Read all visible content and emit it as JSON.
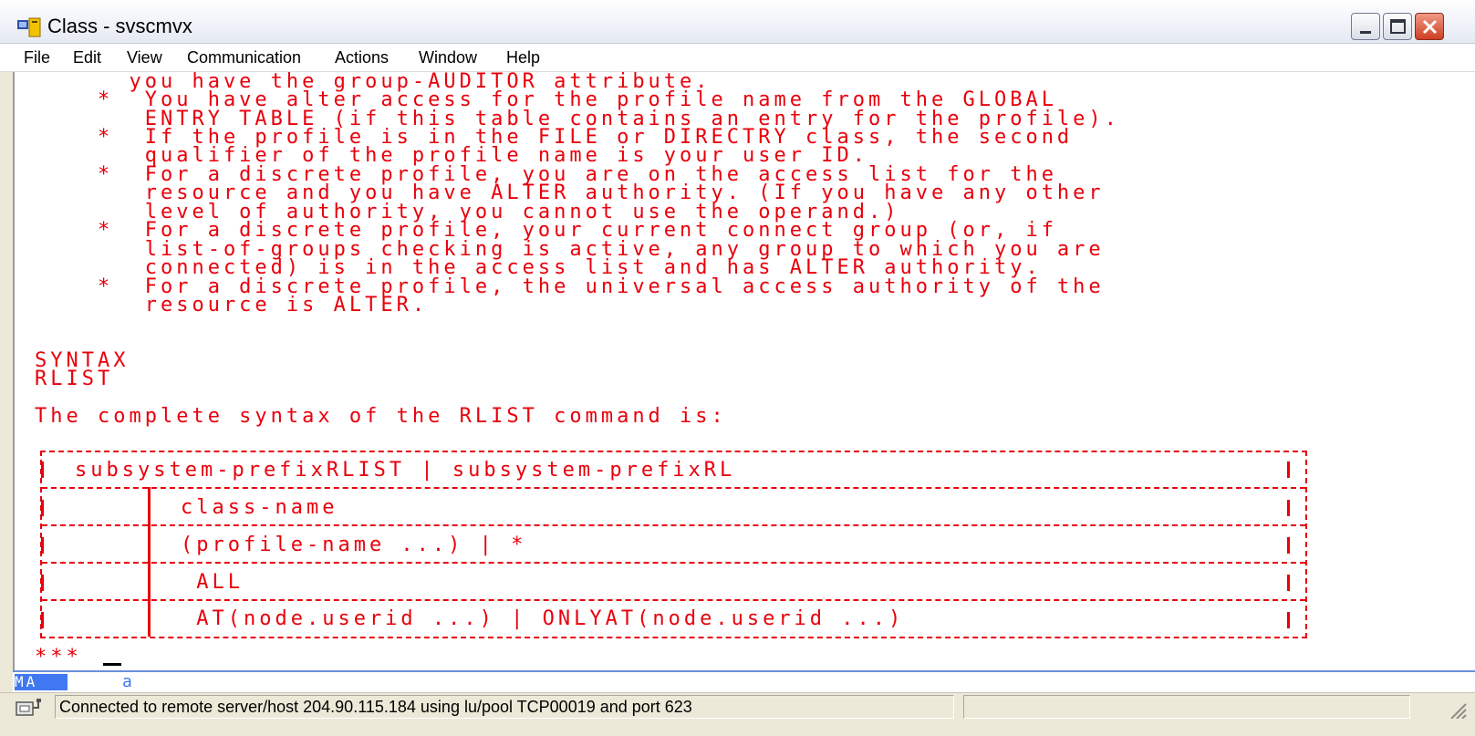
{
  "window": {
    "title": "Class - svscmvx"
  },
  "menu": [
    {
      "label": "File"
    },
    {
      "label": "Edit"
    },
    {
      "label": "View"
    },
    {
      "label": "Communication"
    },
    {
      "label": "Actions"
    },
    {
      "label": "Window"
    },
    {
      "label": "Help"
    }
  ],
  "terminal": {
    "lines": [
      "      you have the group-AUDITOR attribute.",
      "    *  You have alter access for the profile name from the GLOBAL",
      "       ENTRY TABLE (if this table contains an entry for the profile).",
      "    *  If the profile is in the FILE or DIRECTRY class, the second",
      "       qualifier of the profile name is your user ID.",
      "    *  For a discrete profile, you are on the access list for the",
      "       resource and you have ALTER authority. (If you have any other",
      "       level of authority, you cannot use the operand.)",
      "    *  For a discrete profile, your current connect group (or, if",
      "       list-of-groups checking is active, any group to which you are",
      "       connected) is in the access list and has ALTER authority.",
      "    *  For a discrete profile, the universal access authority of the",
      "       resource is ALTER."
    ],
    "syntax_heading": "SYNTAX",
    "syntax_command": "RLIST",
    "syntax_intro": "The complete syntax of the RLIST command is:",
    "table_rows": [
      "subsystem-prefixRLIST | subsystem-prefixRL",
      "class-name",
      "(profile-name ...) | *",
      " ALL",
      " AT(node.userid ...) | ONLYAT(node.userid ...)"
    ],
    "prompt": "***"
  },
  "oia": {
    "mode": "MA",
    "indicator": "a"
  },
  "status": {
    "connection": "Connected to remote server/host 204.90.115.184 using lu/pool TCP00019 and port 623",
    "secondary": ""
  },
  "colors": {
    "terminal_text": "#e8000b",
    "oia_accent": "#3f78f0"
  }
}
